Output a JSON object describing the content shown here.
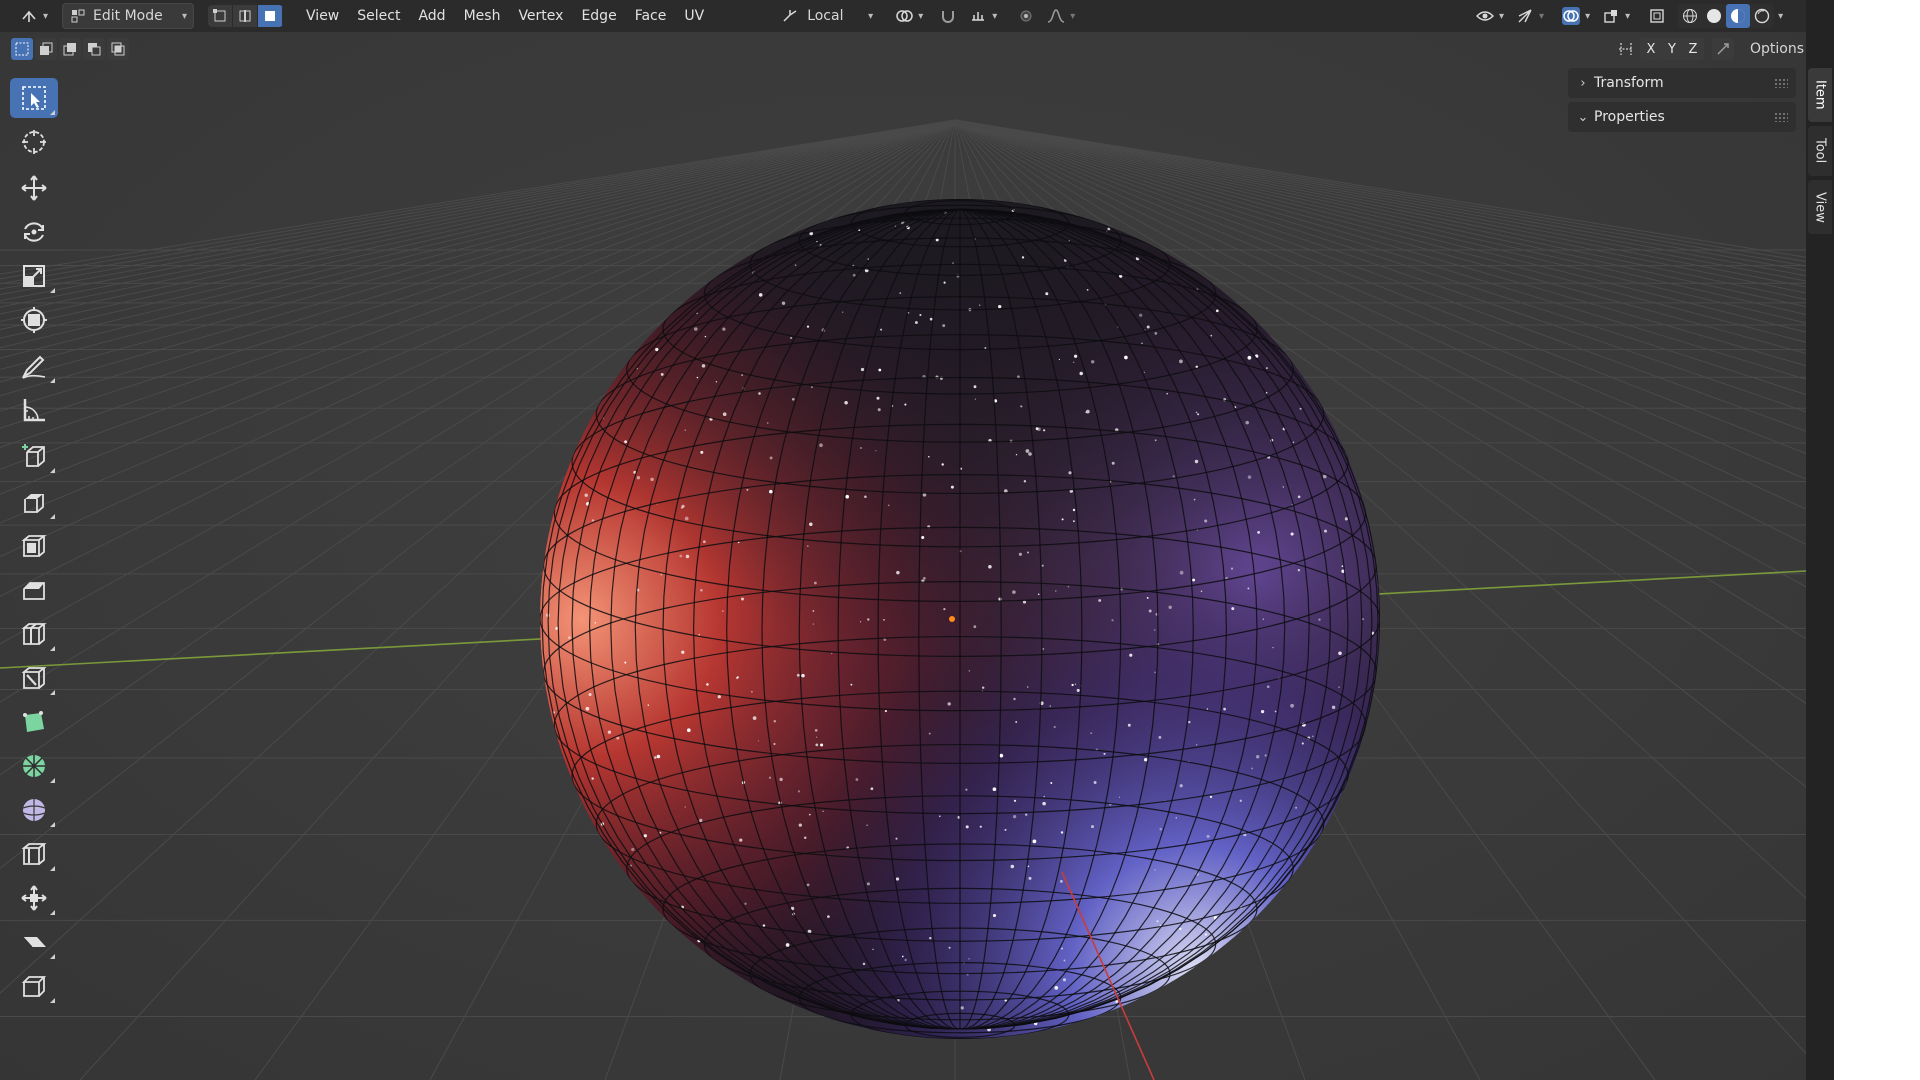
{
  "header": {
    "mode_label": "Edit Mode",
    "menus": [
      "View",
      "Select",
      "Add",
      "Mesh",
      "Vertex",
      "Edge",
      "Face",
      "UV"
    ],
    "transform_orientation": "Local"
  },
  "subheader": {
    "axes": [
      "X",
      "Y",
      "Z"
    ],
    "options_label": "Options"
  },
  "npanel": {
    "transform_label": "Transform",
    "properties_label": "Properties"
  },
  "side_tabs": [
    "Item",
    "Tool",
    "View"
  ],
  "colors": {
    "accent": "#4772b3",
    "viewport_bg": "#393939",
    "header_bg": "#2b2b2b",
    "grid_line": "#4a4a4a",
    "x_axis": "#c83c3c",
    "y_axis": "#7a9a3a",
    "origin": "#ff8c1a"
  },
  "toolbar_tools": [
    "select-box-icon",
    "cursor-icon",
    "move-icon",
    "rotate-icon",
    "scale-icon",
    "transform-icon",
    "annotate-icon",
    "measure-icon",
    "add-cube-icon",
    "extrude-icon",
    "inset-icon",
    "bevel-icon",
    "loop-cut-icon",
    "knife-icon",
    "poly-build-icon",
    "spin-icon",
    "smooth-icon",
    "edge-slide-icon",
    "shrink-fatten-icon",
    "shear-icon",
    "rip-icon"
  ]
}
